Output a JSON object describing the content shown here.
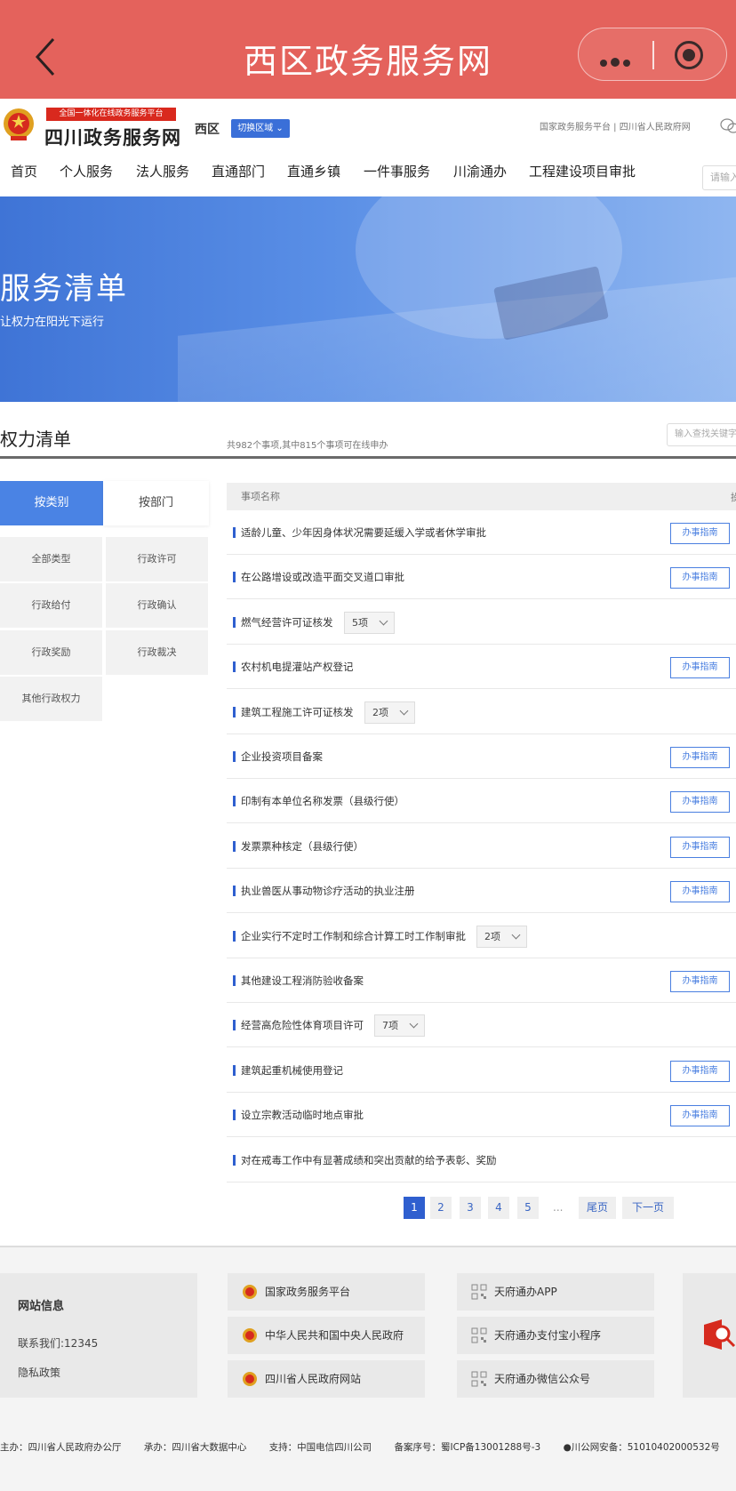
{
  "app_bar": {
    "title": "西区政务服务网"
  },
  "header": {
    "banner_tag": "全国一体化在线政务服务平台",
    "site_name": "四川政务服务网",
    "region": "西区",
    "switch_region": "切换区域",
    "top_links": "国家政务服务平台 | 四川省人民政府网"
  },
  "nav": {
    "items": [
      "首页",
      "个人服务",
      "法人服务",
      "直通部门",
      "直通乡镇",
      "一件事服务",
      "川渝通办",
      "工程建设项目审批"
    ],
    "search_placeholder": "请输入"
  },
  "hero": {
    "title": "服务清单",
    "subtitle": "让权力在阳光下运行"
  },
  "power_list": {
    "title": "权力清单",
    "count_text": "共982个事项,其中815个事项可在线申办",
    "search_placeholder": "输入查找关键字"
  },
  "tabs": {
    "by_category": "按类别",
    "by_department": "按部门"
  },
  "categories": [
    "全部类型",
    "行政许可",
    "行政给付",
    "行政确认",
    "行政奖励",
    "行政裁决",
    "其他行政权力"
  ],
  "table": {
    "header_name": "事项名称",
    "header_right": "操",
    "guide_label": "办事指南",
    "rows": [
      {
        "name": "适龄儿童、少年因身体状况需要延缓入学或者休学审批",
        "guide": true,
        "count": ""
      },
      {
        "name": "在公路增设或改造平面交叉道口审批",
        "guide": true,
        "count": ""
      },
      {
        "name": "燃气经营许可证核发",
        "guide": false,
        "count": "5项"
      },
      {
        "name": "农村机电提灌站产权登记",
        "guide": true,
        "count": ""
      },
      {
        "name": "建筑工程施工许可证核发",
        "guide": false,
        "count": "2项"
      },
      {
        "name": "企业投资项目备案",
        "guide": true,
        "count": ""
      },
      {
        "name": "印制有本单位名称发票（县级行使）",
        "guide": true,
        "count": ""
      },
      {
        "name": "发票票种核定（县级行使）",
        "guide": true,
        "count": ""
      },
      {
        "name": "执业兽医从事动物诊疗活动的执业注册",
        "guide": true,
        "count": ""
      },
      {
        "name": "企业实行不定时工作制和综合计算工时工作制审批",
        "guide": false,
        "count": "2项"
      },
      {
        "name": "其他建设工程消防验收备案",
        "guide": true,
        "count": ""
      },
      {
        "name": "经营高危险性体育项目许可",
        "guide": false,
        "count": "7项"
      },
      {
        "name": "建筑起重机械使用登记",
        "guide": true,
        "count": ""
      },
      {
        "name": "设立宗教活动临时地点审批",
        "guide": true,
        "count": ""
      },
      {
        "name": "对在戒毒工作中有显著成绩和突出贡献的给予表彰、奖励",
        "guide": false,
        "count": ""
      }
    ]
  },
  "pagination": {
    "pages": [
      "1",
      "2",
      "3",
      "4",
      "5"
    ],
    "active": "1",
    "ellipsis": "...",
    "last": "尾页",
    "next": "下一页"
  },
  "footer": {
    "site_info_title": "网站信息",
    "contact": "联系我们:12345",
    "privacy": "隐私政策",
    "links": [
      "国家政务服务平台",
      "中华人民共和国中央人民政府",
      "四川省人民政府网站"
    ],
    "apps": [
      "天府通办APP",
      "天府通办支付宝小程序",
      "天府通办微信公众号"
    ],
    "copyright": [
      "主办：四川省人民政府办公厅",
      "承办：四川省大数据中心",
      "支持：中国电信四川公司",
      "备案序号：蜀ICP备13001288号-3",
      "川公网安备：51010402000532号"
    ]
  },
  "colors": {
    "app_bar": "#e4625c",
    "primary_blue": "#2f5fcf",
    "accent_red": "#d9291e"
  }
}
